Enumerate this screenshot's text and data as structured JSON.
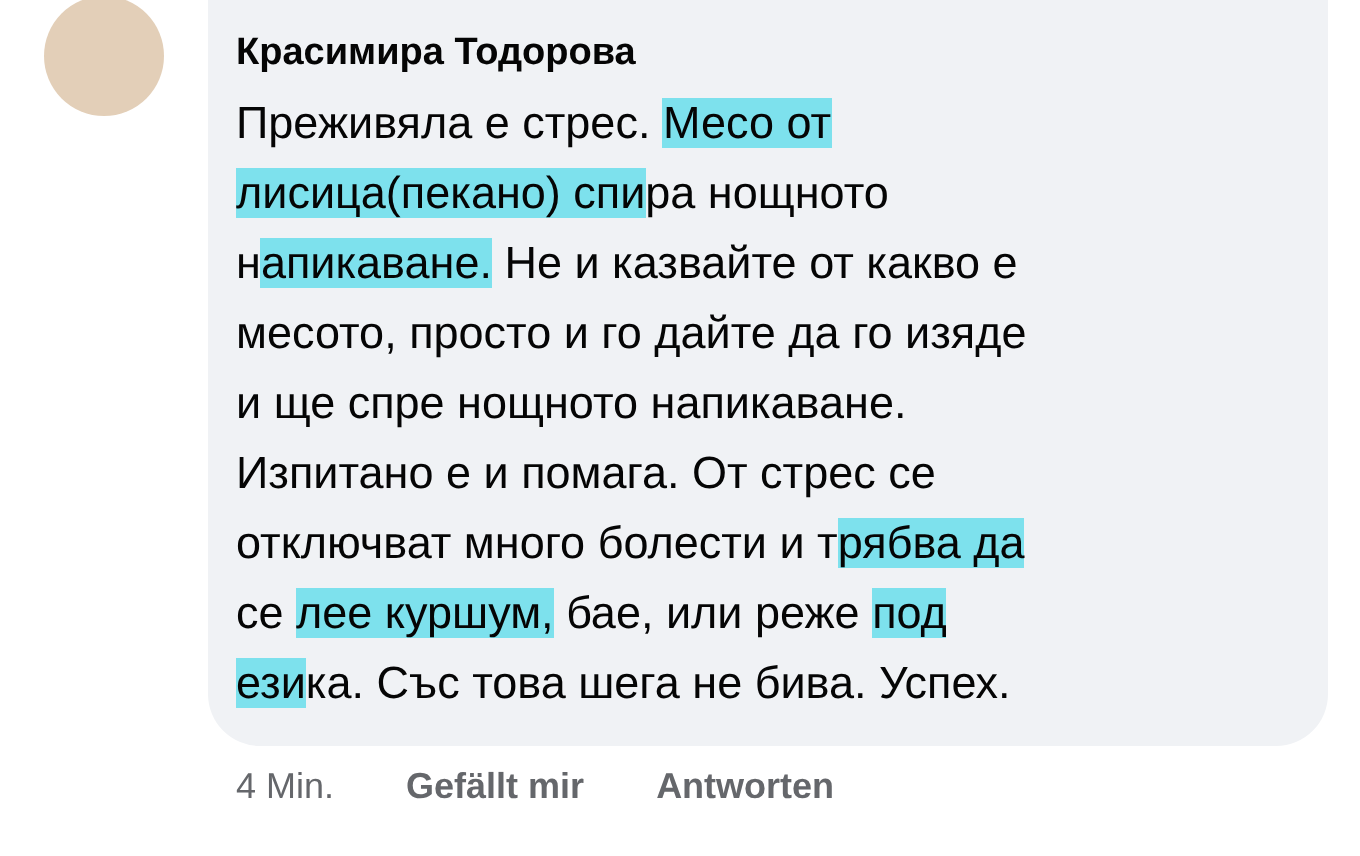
{
  "comment": {
    "author": "Красимира Тодорова",
    "lines": [
      [
        {
          "text": "Преживяла е стрес. ",
          "highlighted": false
        },
        {
          "text": "Месо от",
          "highlighted": true
        }
      ],
      [
        {
          "text": "лисица(пекано) спи",
          "highlighted": true
        },
        {
          "text": "ра нощното",
          "highlighted": false
        }
      ],
      [
        {
          "text": "н",
          "highlighted": false
        },
        {
          "text": "апикаване.",
          "highlighted": true
        },
        {
          "text": " Не и казвайте от какво е",
          "highlighted": false
        }
      ],
      [
        {
          "text": "месото, просто и го дайте да го изяде",
          "highlighted": false
        }
      ],
      [
        {
          "text": "и ще спре нощното напикаване.",
          "highlighted": false
        }
      ],
      [
        {
          "text": "Изпитано е и помага. От стрес се",
          "highlighted": false
        }
      ],
      [
        {
          "text": "отключват много болести и т",
          "highlighted": false
        },
        {
          "text": "рябва да",
          "highlighted": true
        }
      ],
      [
        {
          "text": "се ",
          "highlighted": false
        },
        {
          "text": "лее куршум,",
          "highlighted": true
        },
        {
          "text": " бае, или реже ",
          "highlighted": false
        },
        {
          "text": "под",
          "highlighted": true
        }
      ],
      [
        {
          "text": "ези",
          "highlighted": true
        },
        {
          "text": "ка. Със това шега не бива. Успех.",
          "highlighted": false
        }
      ]
    ]
  },
  "actions": [
    {
      "label": "4 Min.",
      "kind": "time"
    },
    {
      "label": "Gefällt mir",
      "kind": "link"
    },
    {
      "label": "Antworten",
      "kind": "link"
    }
  ]
}
